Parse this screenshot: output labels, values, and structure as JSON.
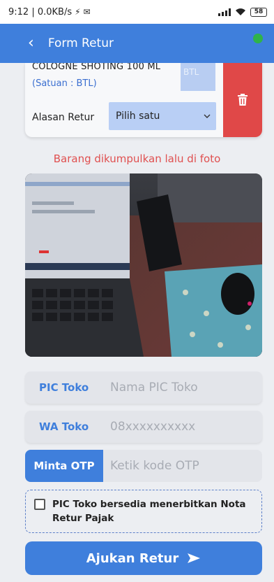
{
  "status": {
    "time_speed": "9:12 | 0.0KB/s",
    "battery": "58"
  },
  "header": {
    "title": "Form Retur"
  },
  "item": {
    "name": "COLOGNE SHOTING 100 ML",
    "unit": "(Satuan : BTL)",
    "qty_placeholder": "BTL",
    "reason_label": "Alasan Retur",
    "reason_value": "Pilih satu"
  },
  "hint": "Barang dikumpulkan lalu di foto",
  "form": {
    "pic_label": "PIC Toko",
    "pic_placeholder": "Nama PIC Toko",
    "wa_label": "WA Toko",
    "wa_placeholder": "08xxxxxxxxxx",
    "otp_button": "Minta OTP",
    "otp_placeholder": "Ketik kode OTP",
    "agree_text": "PIC Toko bersedia menerbitkan Nota Retur Pajak",
    "submit_label": "Ajukan Retur"
  },
  "colors": {
    "primary": "#3f7fdc",
    "danger": "#e04848",
    "online": "#2fb34a"
  }
}
